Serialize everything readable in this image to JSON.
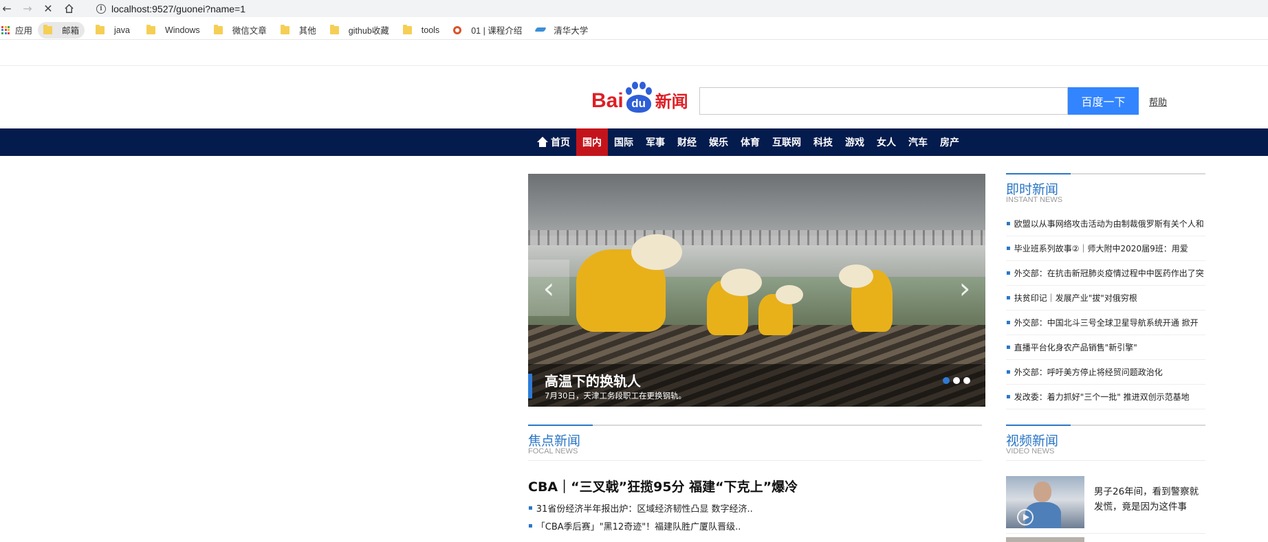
{
  "browser": {
    "back_icon": "arrow-left-icon",
    "forward_icon": "arrow-right-icon",
    "stop_icon": "close-icon",
    "home_icon": "home-icon",
    "url": "localhost:9527/guonei?name=1"
  },
  "bookmarks": {
    "apps_label": "应用",
    "items": [
      {
        "label": "邮箱",
        "icon": "folder-icon"
      },
      {
        "label": "java",
        "icon": "folder-icon"
      },
      {
        "label": "Windows",
        "icon": "folder-icon"
      },
      {
        "label": "微信文章",
        "icon": "folder-icon"
      },
      {
        "label": "其他",
        "icon": "folder-icon"
      },
      {
        "label": "github收藏",
        "icon": "folder-icon"
      },
      {
        "label": "tools",
        "icon": "folder-icon"
      },
      {
        "label": "01 | 课程介绍",
        "icon": "gitee-icon"
      },
      {
        "label": "清华大学",
        "icon": "tsinghua-icon"
      }
    ]
  },
  "header": {
    "logo_text_bai": "Bai",
    "logo_text_du": "du",
    "logo_text_news": "新闻",
    "search_value": "",
    "search_button": "百度一下",
    "help": "帮助"
  },
  "navbar": {
    "items": [
      "首页",
      "国内",
      "国际",
      "军事",
      "财经",
      "娱乐",
      "体育",
      "互联网",
      "科技",
      "游戏",
      "女人",
      "汽车",
      "房产"
    ],
    "active": "国内"
  },
  "slider": {
    "title": "高温下的换轨人",
    "subtitle": "7月30日，天津工务段职工在更换钢轨。",
    "prev_icon": "chevron-left-icon",
    "next_icon": "chevron-right-icon",
    "dots": 3,
    "active_dot": 0
  },
  "instant_news": {
    "title": "即时新闻",
    "subtitle": "INSTANT NEWS",
    "items": [
      "欧盟以从事网络攻击活动为由制裁俄罗斯有关个人和",
      "毕业班系列故事②｜师大附中2020届9班：用爱",
      "外交部：在抗击新冠肺炎疫情过程中中医药作出了突",
      "扶贫印记｜发展产业\"拔\"对俄穷根",
      "外交部：中国北斗三号全球卫星导航系统开通 掀开",
      "直播平台化身农产品销售\"新引擎\"",
      "外交部：呼吁美方停止将经贸问题政治化",
      "发改委：着力抓好\"三个一批\" 推进双创示范基地"
    ]
  },
  "focal_news": {
    "title": "焦点新闻",
    "subtitle": "FOCAL NEWS",
    "headline": "CBA｜“三叉戟”狂揽95分 福建“下克上”爆冷",
    "items": [
      "31省份经济半年报出炉：区域经济韧性凸显 数字经济..",
      "「CBA季后赛」\"黑12奇迹\"！福建队胜广厦队晋级.."
    ]
  },
  "video_news": {
    "title": "视频新闻",
    "subtitle": "VIDEO NEWS",
    "items": [
      {
        "text": "男子26年间，看到警察就发慌，竟是因为这件事"
      }
    ]
  },
  "colors": {
    "accent": "#2a76c6",
    "navbar": "#041b4d",
    "nav_active": "#c4141b",
    "search_button": "#3385ff",
    "logo_red": "#de1f26",
    "logo_blue": "#2e5fd8"
  }
}
